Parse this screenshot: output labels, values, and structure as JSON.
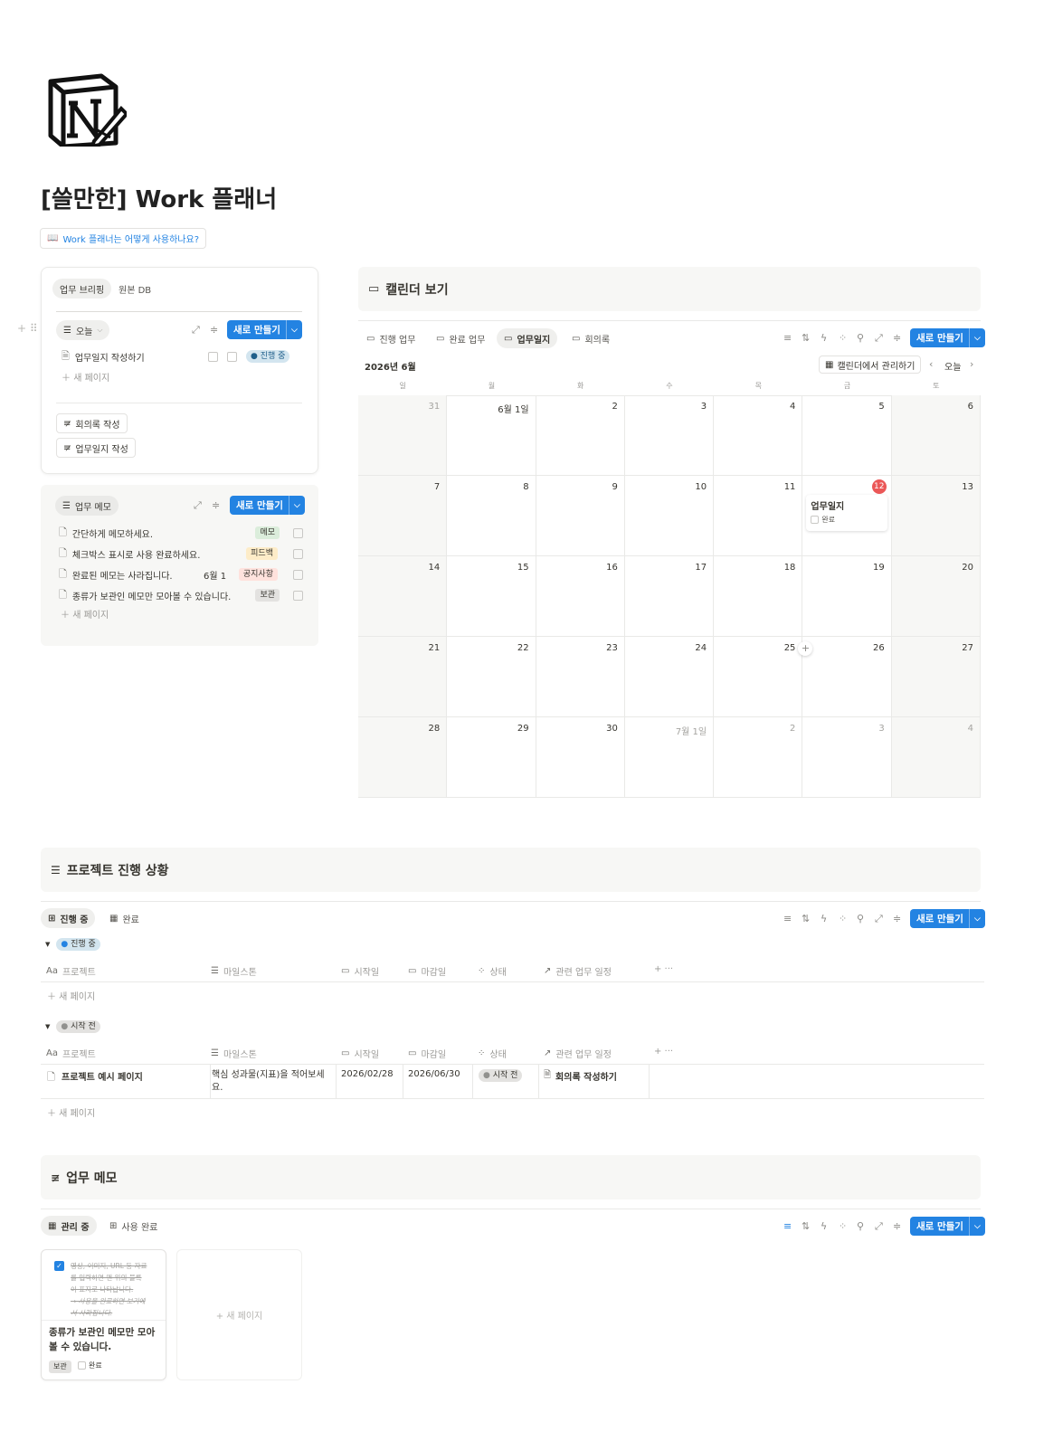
{
  "page": {
    "title": "[쓸만한] Work 플래너",
    "guide_link": "Work 플래너는 어떻게 사용하나요?"
  },
  "colors": {
    "accent": "#2383e2",
    "today": "#eb5757"
  },
  "briefing": {
    "tabs": [
      "업무 브리핑",
      "원본 DB"
    ],
    "view": "오늘",
    "new_btn": "새로 만들기",
    "rows": [
      {
        "title": "업무일지 작성하기",
        "status": "진행 중"
      }
    ],
    "new_page": "새 페이지",
    "buttons": [
      "회의록 작성",
      "업무일지 작성"
    ]
  },
  "memo_panel": {
    "view": "업무 메모",
    "new_btn": "새로 만들기",
    "rows": [
      {
        "title": "간단하게 메모하세요.",
        "date": "",
        "tag": "메모",
        "tag_color": "#dbeddb"
      },
      {
        "title": "체크박스 표시로 사용 완료하세요.",
        "date": "",
        "tag": "피드백",
        "tag_color": "#fdecc8"
      },
      {
        "title": "완료된 메모는 사라집니다.",
        "date": "6월 1",
        "tag": "공지사항",
        "tag_color": "#ffe2dd"
      },
      {
        "title": "종류가 보관인 메모만 모아볼 수 있습니다.",
        "date": "",
        "tag": "보관",
        "tag_color": "#e3e2e0"
      }
    ],
    "new_page": "새 페이지"
  },
  "calendar": {
    "title": "캘린더 보기",
    "tabs": [
      "진행 업무",
      "완료 업무",
      "업무일지",
      "회의록"
    ],
    "active_tab": 2,
    "new_btn": "새로 만들기",
    "month": "2026년 6월",
    "manage_btn": "캘린더에서 관리하기",
    "today_btn": "오늘",
    "weekdays": [
      "일",
      "월",
      "화",
      "수",
      "목",
      "금",
      "토"
    ],
    "weeks": [
      [
        "31",
        "6월 1일",
        "2",
        "3",
        "4",
        "5",
        "6"
      ],
      [
        "7",
        "8",
        "9",
        "10",
        "11",
        "12",
        "13"
      ],
      [
        "14",
        "15",
        "16",
        "17",
        "18",
        "19",
        "20"
      ],
      [
        "21",
        "22",
        "23",
        "24",
        "25",
        "26",
        "27"
      ],
      [
        "28",
        "29",
        "30",
        "7월 1일",
        "2",
        "3",
        "4"
      ]
    ],
    "event": {
      "title": "업무일지",
      "check_label": "완료"
    }
  },
  "projects": {
    "title": "프로젝트 진행 상황",
    "tabs": [
      "진행 중",
      "완료"
    ],
    "new_btn": "새로 만들기",
    "columns": [
      "프로젝트",
      "마일스톤",
      "시작일",
      "마감일",
      "상태",
      "관련 업무 일정"
    ],
    "groups": [
      {
        "label": "진행 중",
        "color": "#d3e5ef",
        "dot": "#2383e2",
        "rows": []
      },
      {
        "label": "시작 전",
        "color": "#e3e2e0",
        "dot": "#91918e",
        "rows": [
          {
            "name": "프로젝트 예시 페이지",
            "milestone1": "핵심 성과물(지표)을 적어보세",
            "milestone2": "요.",
            "start": "2026/02/28",
            "end": "2026/06/30",
            "status": "시작 전",
            "related": "회의록 작성하기"
          }
        ]
      }
    ],
    "new_page": "새 페이지"
  },
  "memos": {
    "title": "업무 메모",
    "tabs": [
      "관리 중",
      "사용 완료"
    ],
    "new_btn": "새로 만들기",
    "card": {
      "preview": [
        "영상, 이미지, URL 등 자료",
        "를 입력하면 맨 위의 블록",
        "이 표지로 나타납니다.",
        "→ 사용을 완료하면 보기에",
        "서 사라집니다."
      ],
      "title1": "종류가 보관인 메모만 모아",
      "title2": "볼 수 있습니다.",
      "tag": "보관",
      "check_label": "완료"
    },
    "new_page": "+ 새 페이지"
  }
}
